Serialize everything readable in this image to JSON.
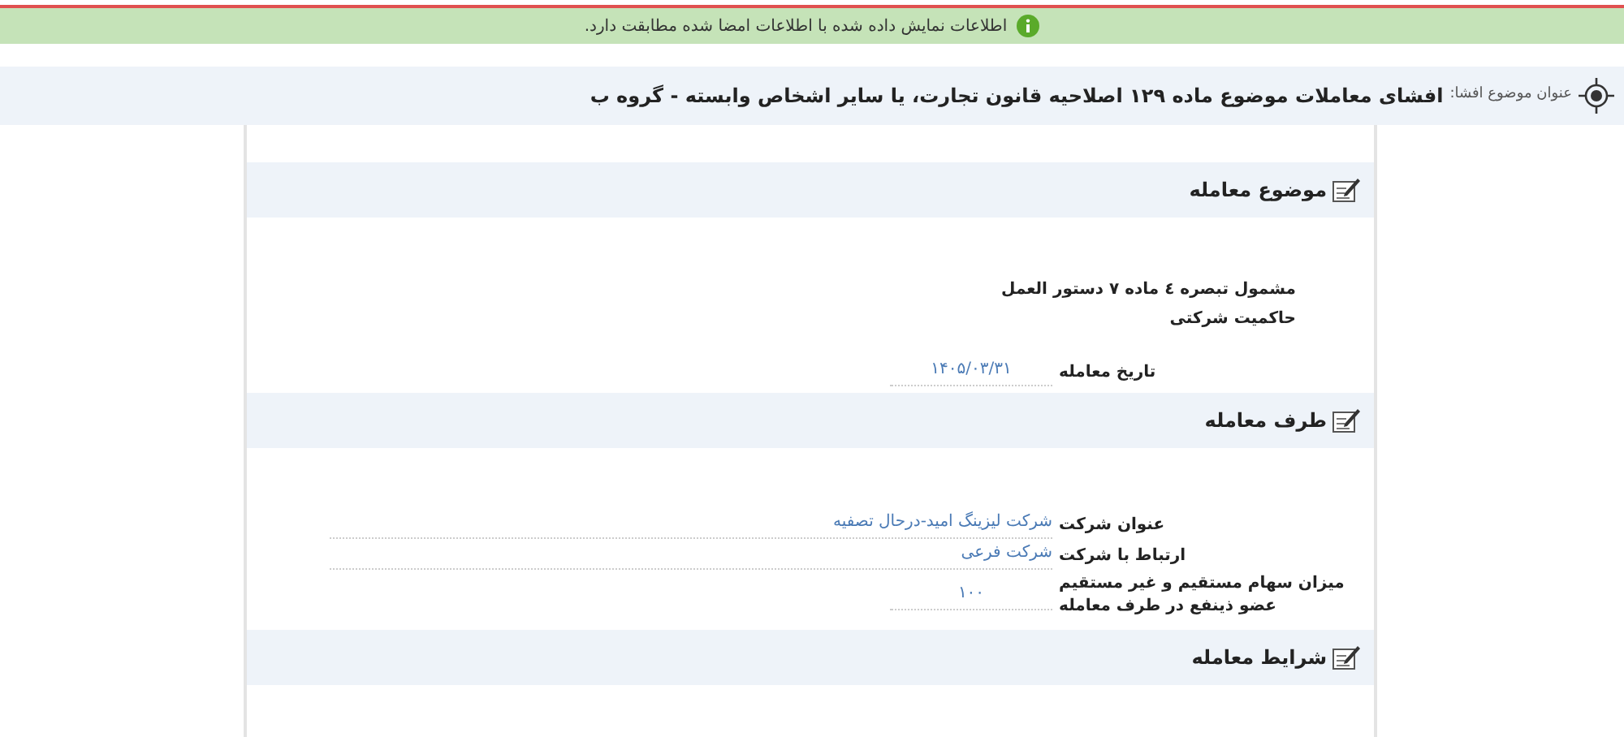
{
  "banner": {
    "text": "اطلاعات نمایش داده شده با اطلاعات امضا شده مطابقت دارد."
  },
  "header": {
    "label": "عنوان موضوع افشا:",
    "title": "افشای معاملات موضوع ماده ۱۲۹ اصلاحیه قانون تجارت، یا سایر اشخاص وابسته - گروه ب"
  },
  "sections": [
    {
      "title": "موضوع معامله",
      "rows": [
        {
          "kind": "note",
          "label": "مشمول تبصره ٤ ماده ۷ دستور العمل حاکمیت شرکتی"
        },
        {
          "kind": "short",
          "label": "تاریخ معامله",
          "value": "۱۴۰۵/۰۳/۳۱"
        }
      ]
    },
    {
      "title": "طرف معامله",
      "rows": [
        {
          "kind": "wide",
          "label": "عنوان شرکت",
          "value": "شرکت لیزینگ امید-درحال تصفیه"
        },
        {
          "kind": "wide",
          "label": "ارتباط با شرکت",
          "value": "شرکت فرعی"
        },
        {
          "kind": "short",
          "label": "میزان سهام مستقیم و غیر مستقیم عضو ذینفع در طرف معامله",
          "value": "۱۰۰"
        }
      ]
    },
    {
      "title": "شرایط معامله"
    }
  ]
}
